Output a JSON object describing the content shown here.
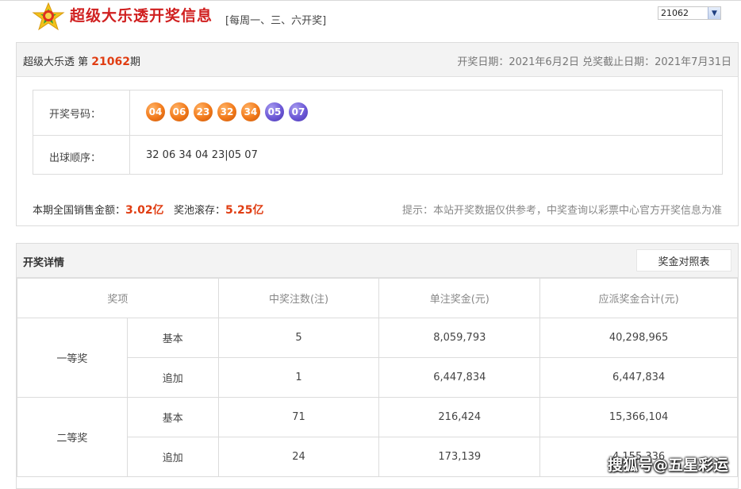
{
  "header": {
    "title": "超级大乐透开奖信息",
    "schedule": "[每周一、三、六开奖]",
    "issue_selected": "21062"
  },
  "draw": {
    "lottery_name": "超级大乐透 第",
    "issue": "21062",
    "issue_suffix": "期",
    "dates": "开奖日期：2021年6月2日 兑奖截止日期：2021年7月31日",
    "numbers_label": "开奖号码：",
    "red_balls": [
      "04",
      "06",
      "23",
      "32",
      "34"
    ],
    "blue_balls": [
      "05",
      "07"
    ],
    "order_label": "出球顺序：",
    "order": "32 06 34 04 23|05 07",
    "sales_label": "本期全国销售金额：",
    "sales_value": "3.02亿",
    "pool_label": "奖池滚存：",
    "pool_value": "5.25亿",
    "tip": "提示：本站开奖数据仅供参考，中奖查询以彩票中心官方开奖信息为准"
  },
  "details": {
    "title": "开奖详情",
    "compare_button": "奖金对照表",
    "columns": [
      "奖项",
      "中奖注数(注)",
      "单注奖金(元)",
      "应派奖金合计(元)"
    ],
    "prizes": [
      {
        "name": "一等奖",
        "rows": [
          {
            "type": "基本",
            "count": "5",
            "single": "8,059,793",
            "total": "40,298,965"
          },
          {
            "type": "追加",
            "count": "1",
            "single": "6,447,834",
            "total": "6,447,834"
          }
        ]
      },
      {
        "name": "二等奖",
        "rows": [
          {
            "type": "基本",
            "count": "71",
            "single": "216,424",
            "total": "15,366,104"
          },
          {
            "type": "追加",
            "count": "24",
            "single": "173,139",
            "total": "4,155,336"
          }
        ]
      }
    ]
  },
  "watermark": "搜狐号@五星彩运",
  "colors": {
    "accent": "#e03d12",
    "title": "#d02020",
    "red_ball": "#f27a1a",
    "blue_ball": "#6c58d6"
  }
}
